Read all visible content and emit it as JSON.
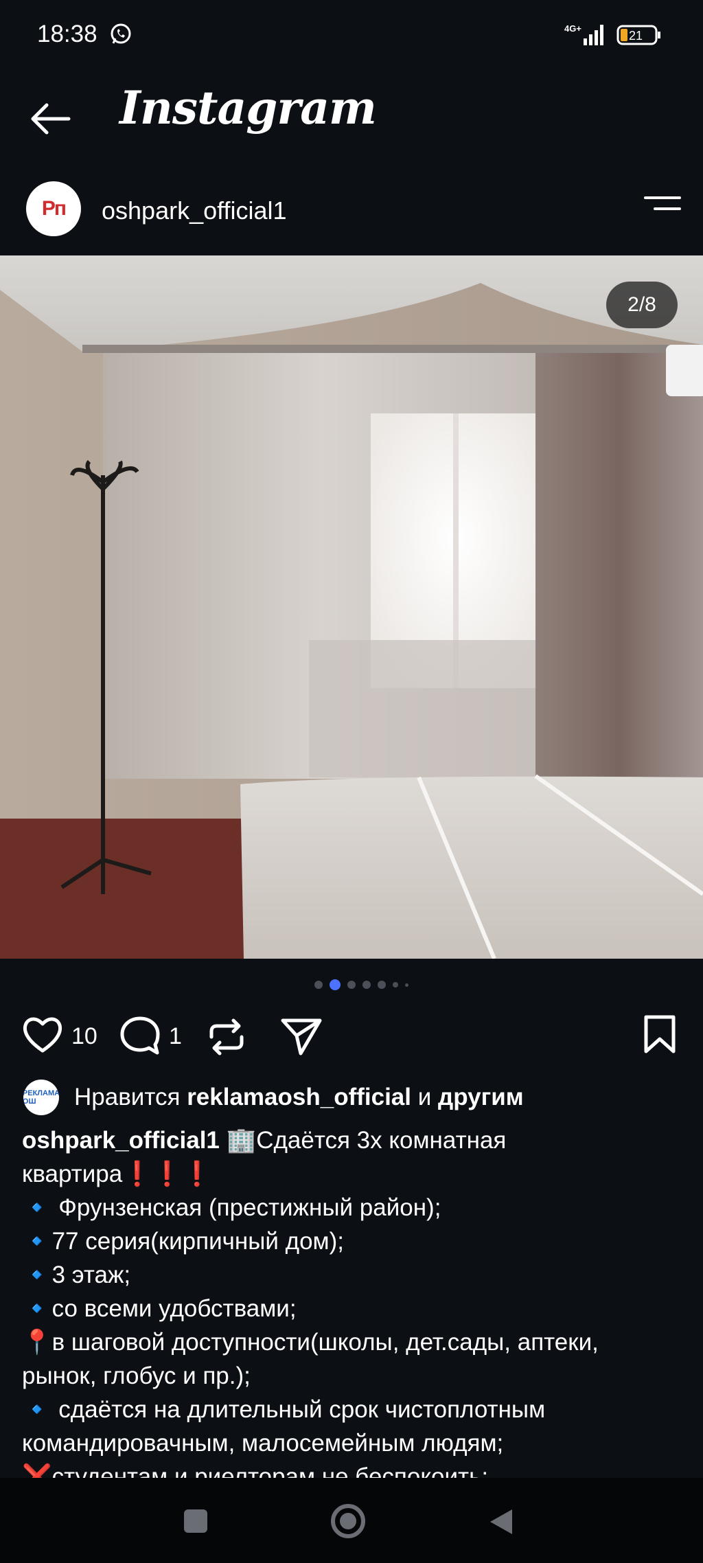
{
  "status_bar": {
    "time": "18:38",
    "network": "4G+",
    "battery": "21",
    "icons": [
      "whatsapp-icon",
      "signal-icon",
      "battery-icon"
    ]
  },
  "header": {
    "title": "Instagram",
    "back_icon": "arrow-left-icon"
  },
  "post": {
    "username": "oshpark_official1",
    "avatar_text": "Рп",
    "menu_icon": "menu-icon",
    "counter": "2/8",
    "slides_total": 8,
    "slide_current": 2,
    "likes_count": "10",
    "comments_count": "1",
    "liked_by_prefix": "Нравится",
    "liked_by_user": "reklamaosh_official",
    "liked_by_conj": "и",
    "liked_by_others": "другим",
    "liked_by_avatar_text": "РЕКЛАМА ОШ"
  },
  "caption": {
    "username": "oshpark_official1",
    "lines": [
      " 🏢Сдаётся 3х комнатная",
      "квартира❗❗❗",
      "🔹 Фрунзенская (престижный район);",
      "🔹77 серия(кирпичный дом);",
      "🔹3 этаж;",
      "🔹со всеми удобствами;",
      "📍в шаговой доступности(школы, дет.сады, аптеки,",
      "рынок, глобус и пр.);",
      "🔹 сдаётся на длительный срок чистоплотным",
      "командировачным, малосемейным людям;",
      "❌студентам и риелторам не беспокоить;"
    ]
  },
  "navbar": {
    "icons": [
      "recents-square-icon",
      "home-circle-icon",
      "back-triangle-icon"
    ]
  },
  "colors": {
    "background": "#0c0f14",
    "accent_dot": "#4c72ff",
    "text": "#ffffff"
  }
}
